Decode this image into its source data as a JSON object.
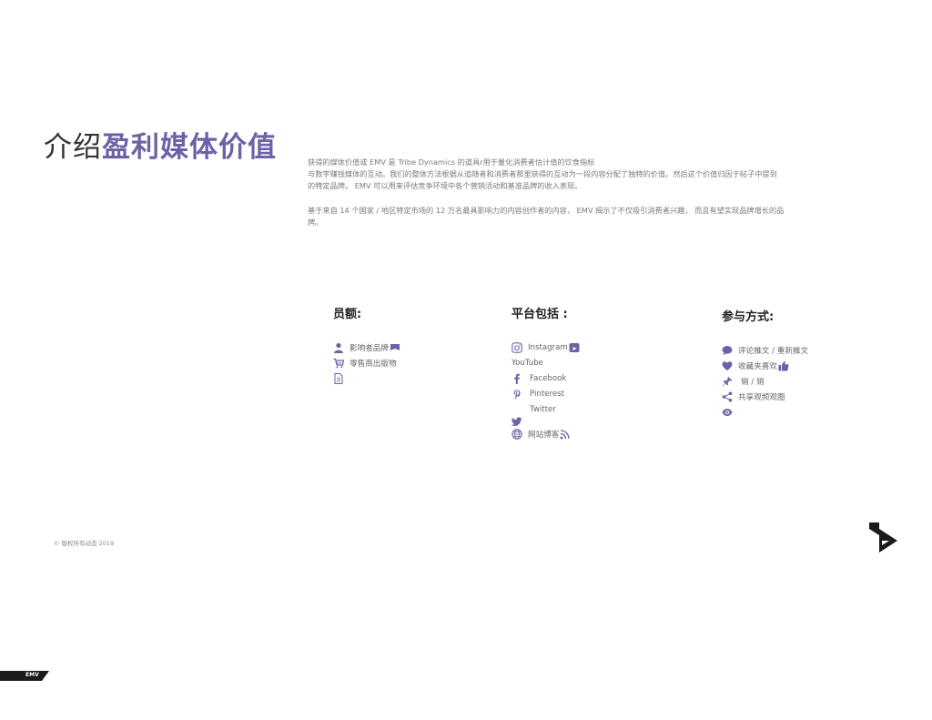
{
  "title": {
    "plain": "介绍",
    "accent": "盈利媒体价值"
  },
  "intro": {
    "p1_line1": "获得的媒体价值或 EMV 是 Tribe Dynamics 的道具r用于量化消费者估计值的饮食指标",
    "p1_line2": "与数字赚钱媒体的互动。我们的整体方法根据从追随者和消费者那里获得的互动为一段内容分配了独特的价值。然后这个价值归因于帖子中提到",
    "p1_line3": "的特定品牌。 EMV 可以用来评估竞争环境中各个营销活动和基准品牌的收入表现。",
    "p2_line1": "基于来自 14 个国家 / 地区特定市场的 12 万名最具影响力的内容创作者的内容， EMV 揭示了不仅吸引消费者兴趣， 而且有望实现品牌增长的品",
    "p2_line2": "牌。"
  },
  "members": {
    "heading": "员额:",
    "items": [
      {
        "label": "影响者品牌",
        "icon": "person-icon",
        "icon2": "flag-icon"
      },
      {
        "label": "零售商出版物",
        "icon": "cart-icon"
      },
      {
        "label": "",
        "icon": "document-icon"
      }
    ]
  },
  "platforms": {
    "heading": "平台包括 :",
    "items": [
      {
        "label": "Instagram",
        "icon": "instagram-icon",
        "icon2": "youtube-icon"
      },
      {
        "label": "YouTube"
      },
      {
        "label": "Facebook",
        "icon": "facebook-icon"
      },
      {
        "label": "Pinterest",
        "icon": "pinterest-icon"
      },
      {
        "label": "Twitter"
      },
      {
        "label": "",
        "icon": "twitter-icon"
      },
      {
        "label": "网站博客",
        "icon": "globe-icon",
        "icon2": "rss-icon"
      }
    ]
  },
  "engagement": {
    "heading": "参与方式:",
    "items": [
      {
        "label": "评论推文 / 重新推文",
        "icon": "comment-icon"
      },
      {
        "label": "收藏夹喜欢",
        "icon": "heart-icon",
        "icon2": "thumbs-up-icon"
      },
      {
        "label": "销 / 销",
        "icon": "pin-icon"
      },
      {
        "label": "共享观频观图",
        "icon": "share-icon"
      },
      {
        "label": "",
        "icon": "eye-icon"
      }
    ]
  },
  "footer": {
    "copyright": "© 版权所有动态 2019"
  },
  "tag": {
    "label": "EMV"
  },
  "colors": {
    "accent": "#6b63a6",
    "logo": "#1a1a1a"
  }
}
